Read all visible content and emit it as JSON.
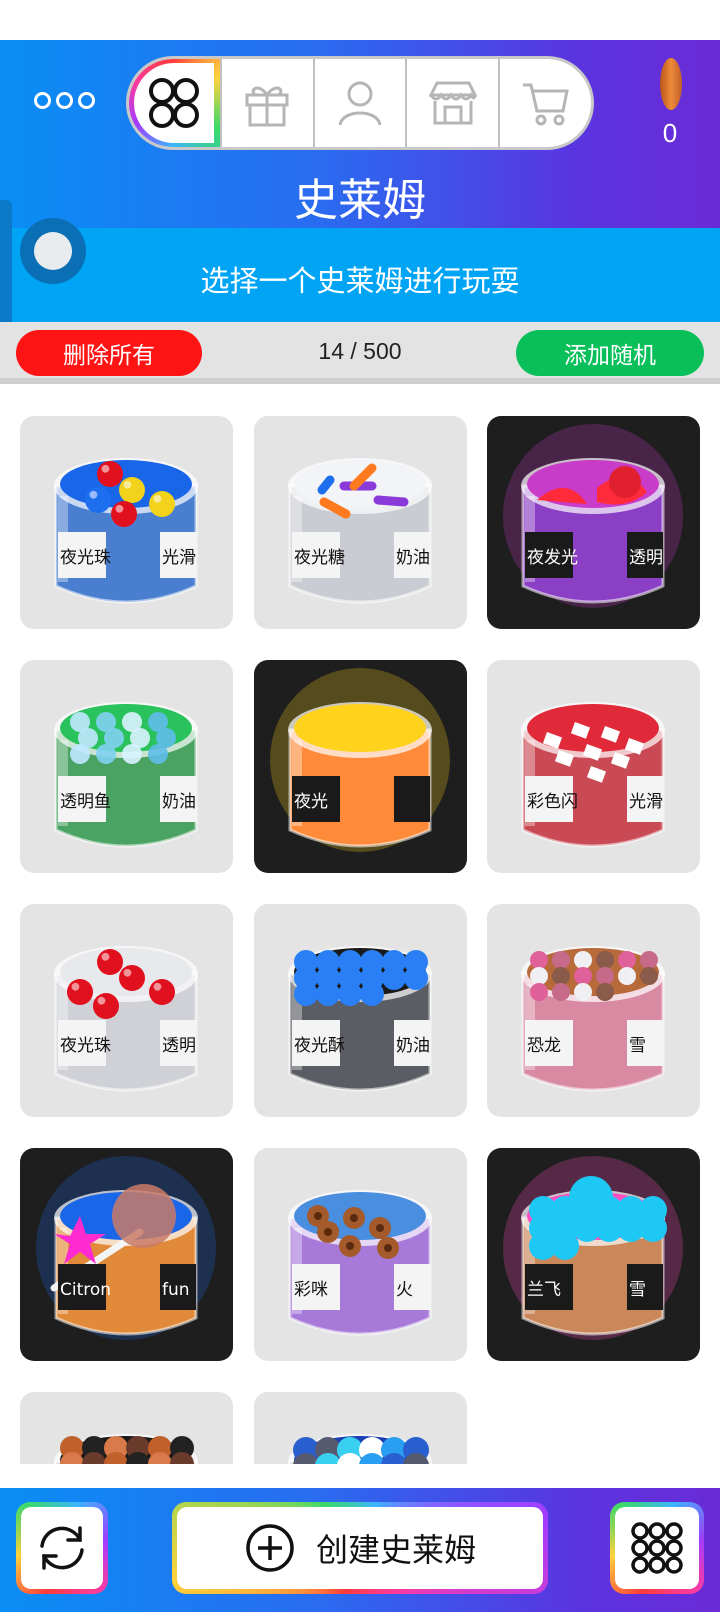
{
  "header": {
    "title": "史莱姆",
    "coin_count": "0",
    "tabs": [
      {
        "icon": "slime-grid-icon"
      },
      {
        "icon": "gift-icon"
      },
      {
        "icon": "user-icon"
      },
      {
        "icon": "shop-icon"
      },
      {
        "icon": "cart-icon"
      }
    ]
  },
  "subtitle": "选择一个史莱姆进行玩耍",
  "actions": {
    "delete_all": "删除所有",
    "counter": "14 / 500",
    "add_random": "添加随机"
  },
  "slimes": [
    {
      "label_left": "夜光珠",
      "label_right": "光滑",
      "dark": false,
      "top_color": "#1a66e8",
      "body_color": "#4a7fd0",
      "toppings": "balls-red-yellow"
    },
    {
      "label_left": "夜光糖",
      "label_right": "奶油",
      "dark": false,
      "top_color": "#f2f4f7",
      "body_color": "#c9ccd2",
      "toppings": "sprinkles"
    },
    {
      "label_left": "夜发光",
      "label_right": "透明",
      "dark": true,
      "top_color": "#c93bc9",
      "body_color": "#8b3fc4",
      "toppings": "fruit"
    },
    {
      "label_left": "透明鱼",
      "label_right": "奶油",
      "dark": false,
      "top_color": "#29c25c",
      "body_color": "#4aa363",
      "toppings": "beads-clear"
    },
    {
      "label_left": "夜光",
      "label_right": "",
      "dark": true,
      "top_color": "#ffd21c",
      "body_color": "#ff8a3a",
      "toppings": "none"
    },
    {
      "label_left": "彩色闪",
      "label_right": "光滑",
      "dark": false,
      "top_color": "#e02a39",
      "body_color": "#c94a55",
      "toppings": "flakes-white"
    },
    {
      "label_left": "夜光珠",
      "label_right": "透明",
      "dark": false,
      "top_color": "#e8e9ec",
      "body_color": "#cfd1d6",
      "toppings": "balls-red"
    },
    {
      "label_left": "夜光酥",
      "label_right": "奶油",
      "dark": false,
      "top_color": "#1a1a1a",
      "body_color": "#5a5d63",
      "toppings": "balls-blue"
    },
    {
      "label_left": "恐龙",
      "label_right": "雪",
      "dark": false,
      "top_color": "#b86a3a",
      "body_color": "#d98aa3",
      "toppings": "pearls-pink"
    },
    {
      "label_left": "Citron",
      "label_right": "fun",
      "dark": true,
      "top_color": "#1a66e8",
      "body_color": "#e08a3a",
      "toppings": "lollipop"
    },
    {
      "label_left": "彩咪",
      "label_right": "火",
      "dark": false,
      "top_color": "#4a8ee0",
      "body_color": "#a77ad9",
      "toppings": "donuts"
    },
    {
      "label_left": "兰飞",
      "label_right": "雪",
      "dark": true,
      "top_color": "#ff4fc0",
      "body_color": "#c9875a",
      "toppings": "balls-cyan"
    },
    {
      "label_left": "",
      "label_right": "",
      "dark": false,
      "top_color": "#1a1a1a",
      "body_color": "#6a6d73",
      "toppings": "balls-brown"
    },
    {
      "label_left": "",
      "label_right": "",
      "dark": false,
      "top_color": "#1a3fb0",
      "body_color": "#6a6d73",
      "toppings": "balls-mixed"
    }
  ],
  "bottom": {
    "create_label": "创建史莱姆"
  }
}
